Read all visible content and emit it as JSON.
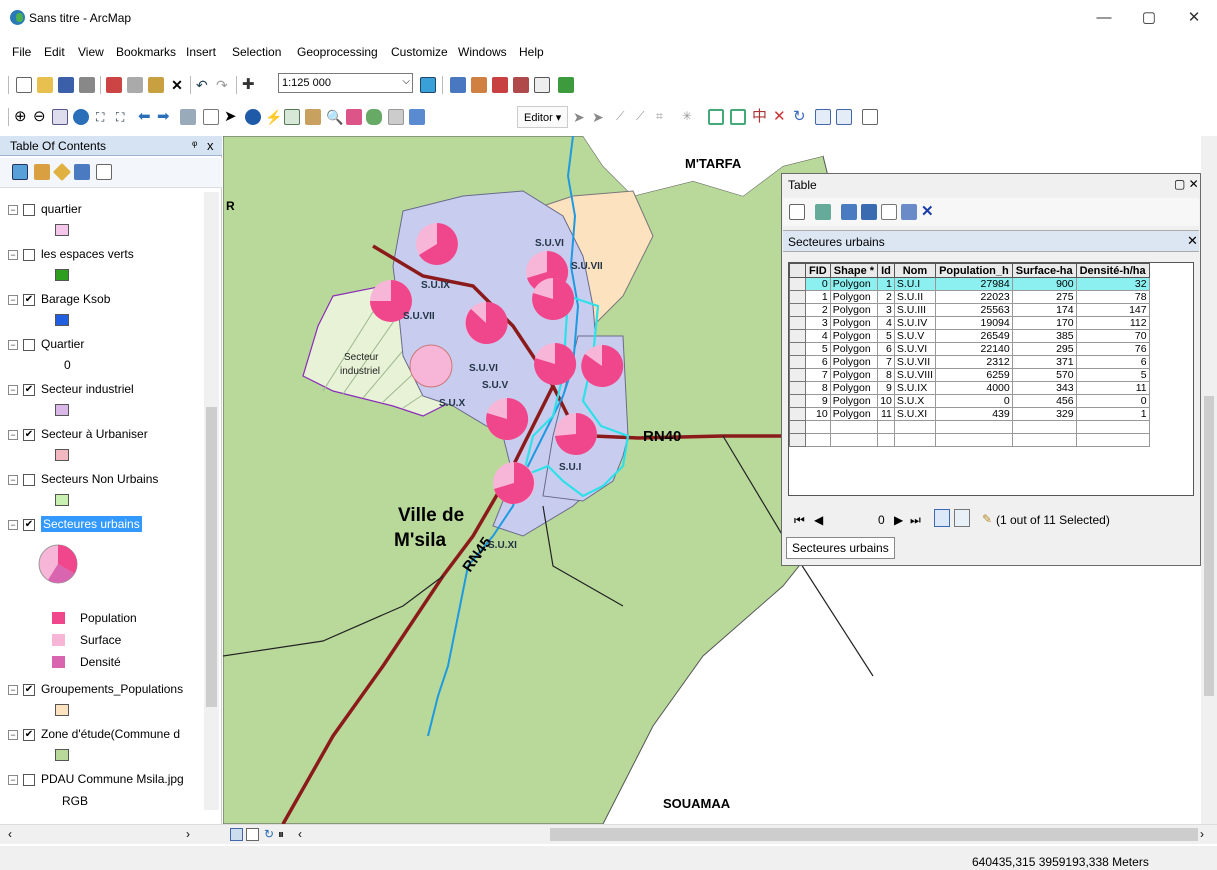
{
  "window": {
    "title": "Sans titre - ArcMap",
    "minimize": "—",
    "restore": "▢",
    "close": "✕"
  },
  "menu": [
    "File",
    "Edit",
    "View",
    "Bookmarks",
    "Insert",
    "Selection",
    "Geoprocessing",
    "Customize",
    "Windows",
    "Help"
  ],
  "toolbar": {
    "scale": "1:125 000",
    "editor_label": "Editor ▾"
  },
  "toc": {
    "title": "Table Of Contents",
    "pin": "ᵠ",
    "close": "x",
    "layers": [
      {
        "label": "quartier",
        "checked": false,
        "swatch": "#f4c6e9"
      },
      {
        "label": "les espaces verts",
        "checked": false,
        "swatch": "#2e9e1e"
      },
      {
        "label": "Barage Ksob",
        "checked": true,
        "swatch": "#1f5fe0"
      },
      {
        "label": "Quartier",
        "checked": false,
        "value": "0"
      },
      {
        "label": "Secteur industriel",
        "checked": true,
        "swatch": "#d9b8e8"
      },
      {
        "label": "Secteur à Urbaniser",
        "checked": true,
        "swatch": "#f2b8c0"
      },
      {
        "label": "Secteurs Non Urbains",
        "checked": false,
        "swatch": "#c8f0b0"
      },
      {
        "label": "Secteures urbains",
        "checked": true,
        "selected": true
      },
      {
        "label": "Groupements_Populations",
        "checked": true,
        "swatch": "#fde2c0"
      },
      {
        "label": "Zone d'étude(Commune d",
        "checked": true,
        "swatch": "#b9d99a"
      },
      {
        "label": "PDAU Commune Msila.jpg",
        "checked": false,
        "value": "RGB"
      }
    ],
    "legend": [
      {
        "label": "Population",
        "color": "#f0468c"
      },
      {
        "label": "Surface",
        "color": "#f7b6d8"
      },
      {
        "label": "Densité",
        "color": "#d964b0"
      }
    ]
  },
  "map": {
    "labels": {
      "mtarfa": "M'TARFA",
      "souamaa": "SOUAMAA",
      "ville1": "Ville de",
      "ville2": "M'sila",
      "rn40": "RN40",
      "rn45": "RN45",
      "secteur1": "Secteur",
      "secteur2": "industriel",
      "r": "R",
      "suvi2": "S.U.VI",
      "suviii": "S.U.VII",
      "suix": "S.U.IX",
      "suvii": "S.U.VII",
      "suvi": "S.U.VI",
      "suv": "S.U.V",
      "sux": "S.U.X",
      "sui": "S.U.I",
      "suxi": "S.U.XI"
    },
    "colors": {
      "zone": "#b9d99a",
      "groupement": "#fde2c0",
      "urbain": "#c8cdf0",
      "road": "#8b1a1a",
      "river": "#1f9ae0",
      "pie_pop": "#f0468c",
      "pie_surf": "#f7b6d8"
    }
  },
  "table": {
    "window_title": "Table",
    "layer_title": "Secteures urbains",
    "columns": [
      "FID",
      "Shape *",
      "Id",
      "Nom",
      "Population_h",
      "Surface-ha",
      "Densité-h/ha"
    ],
    "rows": [
      [
        "0",
        "Polygon",
        "1",
        "S.U.I",
        "27984",
        "900",
        "32"
      ],
      [
        "1",
        "Polygon",
        "2",
        "S.U.II",
        "22023",
        "275",
        "78"
      ],
      [
        "2",
        "Polygon",
        "3",
        "S.U.III",
        "25563",
        "174",
        "147"
      ],
      [
        "3",
        "Polygon",
        "4",
        "S.U.IV",
        "19094",
        "170",
        "112"
      ],
      [
        "4",
        "Polygon",
        "5",
        "S.U.V",
        "26549",
        "385",
        "70"
      ],
      [
        "5",
        "Polygon",
        "6",
        "S.U.VI",
        "22140",
        "295",
        "76"
      ],
      [
        "6",
        "Polygon",
        "7",
        "S.U.VII",
        "2312",
        "371",
        "6"
      ],
      [
        "7",
        "Polygon",
        "8",
        "S.U.VIII",
        "6259",
        "570",
        "5"
      ],
      [
        "8",
        "Polygon",
        "9",
        "S.U.IX",
        "4000",
        "343",
        "11"
      ],
      [
        "9",
        "Polygon",
        "10",
        "S.U.X",
        "0",
        "456",
        "0"
      ],
      [
        "10",
        "Polygon",
        "11",
        "S.U.XI",
        "439",
        "329",
        "1"
      ]
    ],
    "record": "0",
    "selection_text": "(1 out of 11 Selected)",
    "tab_label": "Secteures urbains"
  },
  "status": {
    "coords": "640435,315  3959193,338 Meters"
  }
}
